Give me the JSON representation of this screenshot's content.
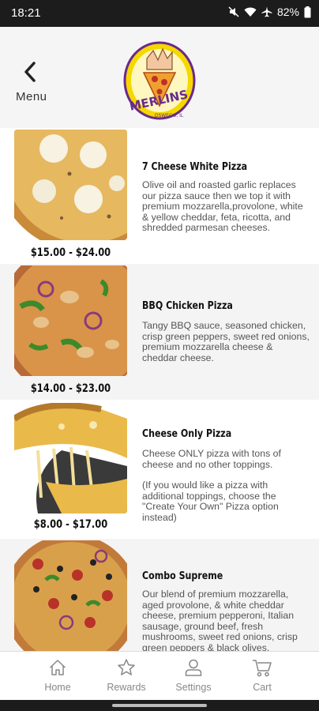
{
  "status_bar": {
    "time": "18:21",
    "battery": "82%",
    "icons": [
      "mute-icon",
      "wifi-icon",
      "airplane-icon",
      "battery-icon"
    ]
  },
  "header": {
    "back_label": "Menu",
    "logo": {
      "brand": "MERLINS",
      "top_text": "BURGERS · PIZZA · HOTDOGS",
      "location": "OSWEGO, IL"
    }
  },
  "items": [
    {
      "name": "7 Cheese White Pizza",
      "price": "$15.00 - $24.00",
      "description": "Olive oil and roasted garlic replaces our pizza sauce then we top it with premium mozzarella,provolone, white & yellow cheddar, feta, ricotta, and shredded parmesan cheeses."
    },
    {
      "name": "BBQ Chicken Pizza",
      "price": "$14.00 - $23.00",
      "description": "Tangy BBQ sauce, seasoned chicken, crisp green peppers, sweet red onions, premium mozzarella cheese & cheddar cheese."
    },
    {
      "name": "Cheese Only Pizza",
      "price": "$8.00 - $17.00",
      "description": "Cheese ONLY pizza with tons of cheese and no other toppings.",
      "note": "(If you would like a pizza with additional toppings, choose the \"Create Your Own\" Pizza option instead)"
    },
    {
      "name": "Combo Supreme",
      "description": "Our blend of premium mozzarella, aged provolone, & white cheddar cheese, premium pepperoni, Italian sausage, ground beef, fresh mushrooms, sweet red onions, crisp green peppers & black olives."
    }
  ],
  "tabs": [
    {
      "label": "Home",
      "icon": "home-icon"
    },
    {
      "label": "Rewards",
      "icon": "star-icon"
    },
    {
      "label": "Settings",
      "icon": "person-icon"
    },
    {
      "label": "Cart",
      "icon": "cart-icon"
    }
  ],
  "colors": {
    "header_bg": "#f5f5f5",
    "alt_row_bg": "#f4f4f4",
    "logo_yellow": "#f2d000",
    "logo_purple": "#6a2a8c"
  }
}
